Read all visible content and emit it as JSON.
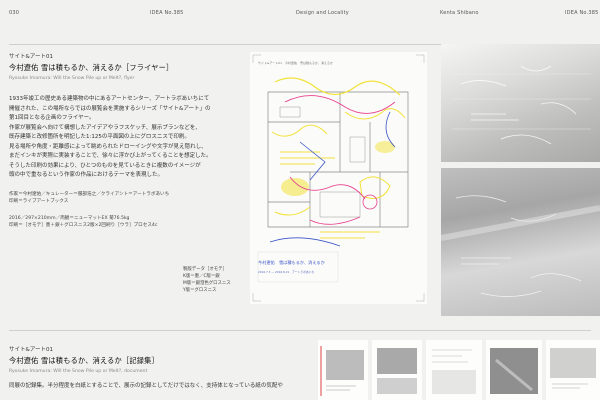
{
  "header": {
    "page_number": "030",
    "issue_left": "IDEA No.385",
    "section": "Design and Locality",
    "author": "Kenta Shibano",
    "issue_right": "IDEA No.385"
  },
  "article1": {
    "kicker": "サイト&アート01",
    "title": "今村遼佑 雪は積もるか、消えるか［フライヤー］",
    "subtitle": "Ryosuke Imamura: Will the Snow Pile up or Melt?, flyer",
    "body": [
      "1933年竣工の歴史ある建築物の中にあるアートセンター、アートラボあいちにて",
      "開催された、この場所ならではの展覧会を実施するシリーズ「サイト&アート」の",
      "第1回目となる企画のフライヤー。",
      "作家が展覧会へ向けて構想したアイデアやラフスケッチ、展示プランなどを、",
      "既存建築と改修箇所を明記した1:125の平面図の上にグロスニスで印刷。",
      "見る場所や角度・距離感によって眺められたドローイングや文字が見え隠れし、",
      "まだインキが実際に実装することで、徐々に浮かび上がってくることを想定した。",
      "そうした印刷の効果により、ひとつのものを見ているときに複数のイメージが",
      "頭の中で重なるという作家の作品におけるテーマを表現した。"
    ],
    "credits": [
      "作家＝今村遼佑／キュレーター＝服部浩之／クライアント＝アートラボあいち",
      "印刷＝ライブアートブックス"
    ],
    "specs": [
      "2016／297×210mm／両観＝ニューマットEX 菊76.5kg",
      "印刷＝［オモテ］墨＋銀＋グロスニス2版×2回刷り［ウラ］プロセス4c"
    ]
  },
  "notes": [
    "製版データ［オモテ］",
    "K版＝墨／C版＝銀",
    "M版＝銀澄色グロスニス",
    "Y版＝グロスニス"
  ],
  "flyer": {
    "head": "サイト&アート01　今村遼佑　雪は積もるか、消えるか",
    "title": "今村遼佑　雪は積もるか、消えるか",
    "sub": "2016.7.3 — 2016.8.21　アートラボあいち"
  },
  "article2": {
    "kicker": "サイト&アート01",
    "title": "今村遼佑 雪は積もるか、消えるか［記録集］",
    "subtitle": "Ryosuke Imamura: Will the Snow Pile up or Melt?, document",
    "body": [
      "同展の記録集。半分程度を白紙とすることで、展示の記録としてだけではなく、支持体となっている紙の気配や"
    ]
  },
  "colors": {
    "background": "#f1f1ef",
    "sketch_yellow": "#f2e23a",
    "sketch_pink": "#e8408f",
    "sketch_blue": "#3a55c8",
    "plan_line": "#8a8a8a"
  }
}
